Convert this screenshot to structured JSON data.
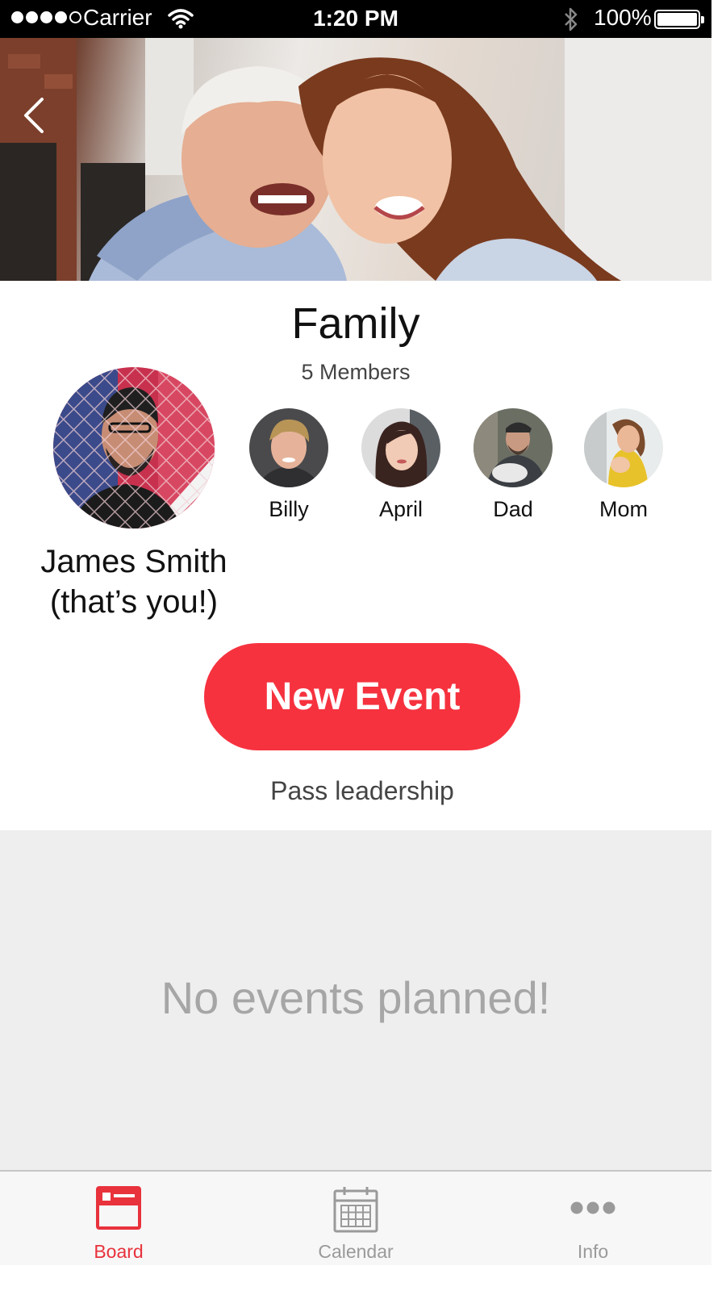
{
  "status_bar": {
    "carrier": "Carrier",
    "time": "1:20 PM",
    "battery": "100%"
  },
  "group": {
    "title": "Family",
    "member_count": "5 Members"
  },
  "current_user": {
    "name_line1": "James Smith",
    "name_line2": "(that’s you!)"
  },
  "members": [
    {
      "name": "Billy"
    },
    {
      "name": "April"
    },
    {
      "name": "Dad"
    },
    {
      "name": "Mom"
    }
  ],
  "actions": {
    "new_event": "New Event",
    "pass_leadership": "Pass leadership"
  },
  "events": {
    "empty_message": "No events planned!"
  },
  "tabs": [
    {
      "label": "Board",
      "icon": "board-icon",
      "active": true
    },
    {
      "label": "Calendar",
      "icon": "calendar-icon",
      "active": false
    },
    {
      "label": "Info",
      "icon": "more-dots-icon",
      "active": false
    }
  ],
  "colors": {
    "accent": "#f6323f",
    "tab_active": "#e8323c",
    "tab_inactive": "#9a9a9a",
    "empty_background": "#eeeeee"
  }
}
